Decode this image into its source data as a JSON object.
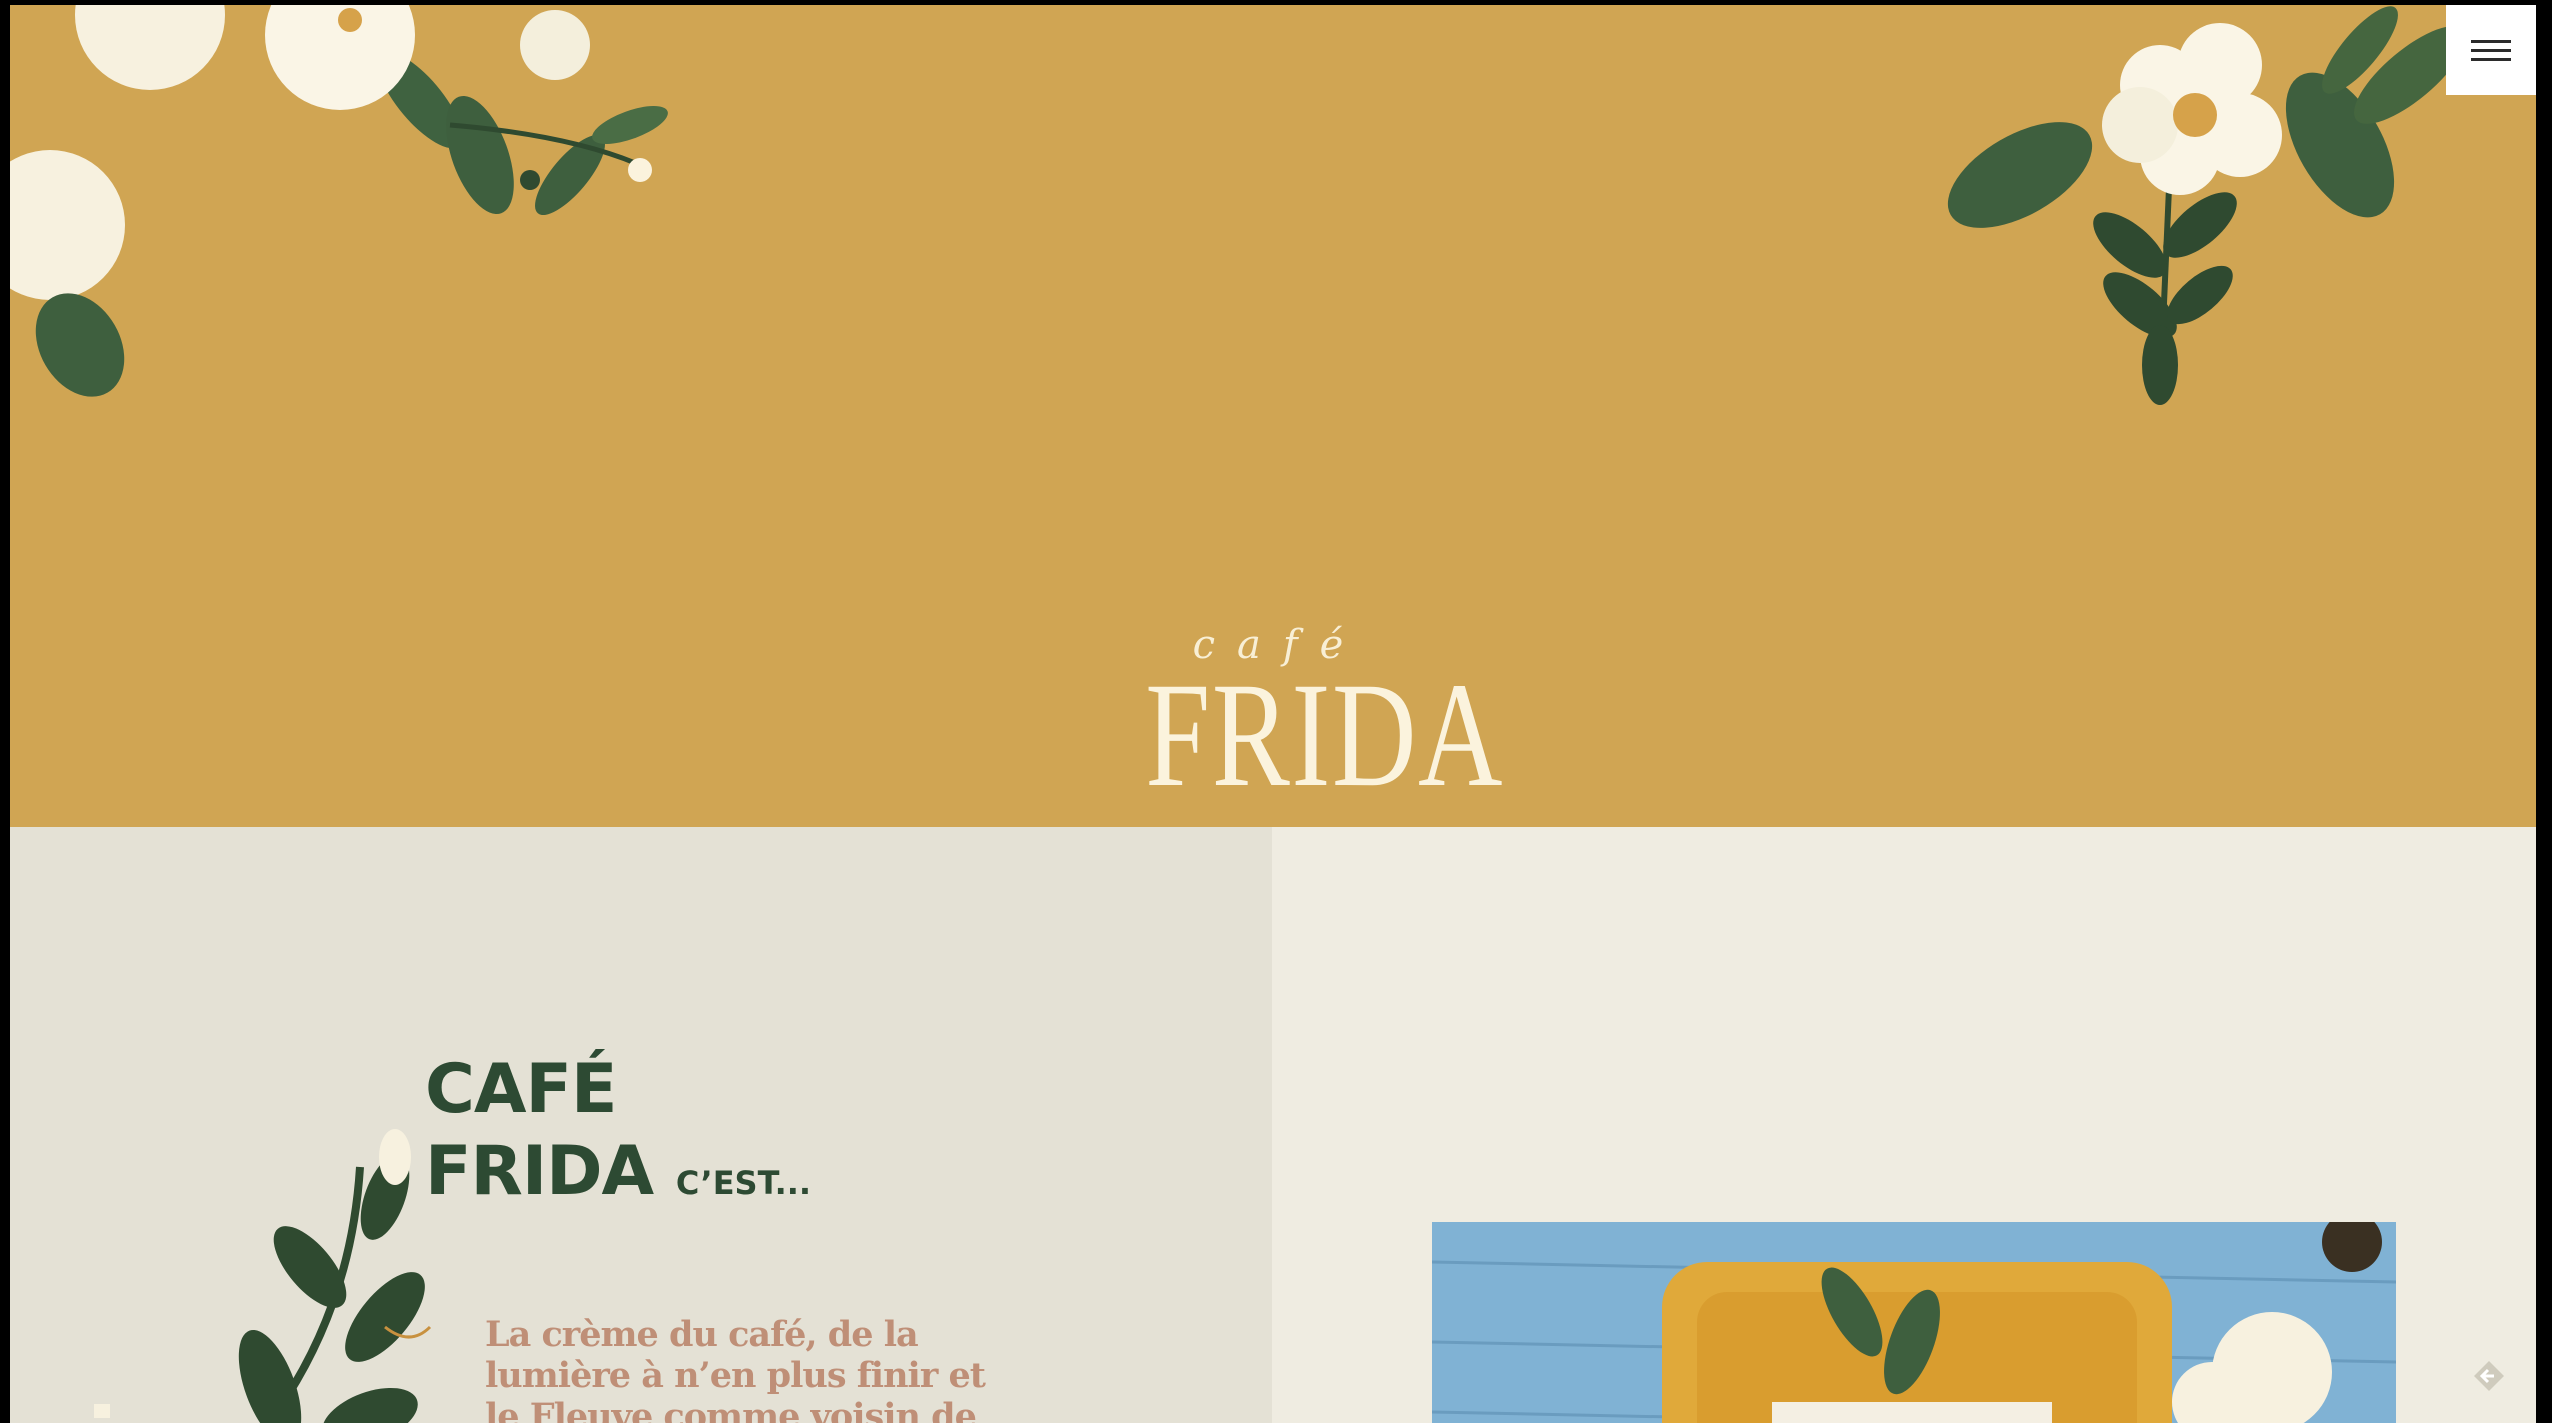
{
  "logo": {
    "small": "café",
    "big": "FRIDA"
  },
  "menu": {
    "icon": "hamburger-menu-icon"
  },
  "about": {
    "title_line1": "CAFÉ",
    "title_line2": "FRIDA",
    "title_suffix": "C’EST...",
    "intro": "La crème du café, de la lumière à n’en plus finir et le Fleuve comme voisin de table. Bienvenue au Frida"
  },
  "colors": {
    "mustard": "#d0a553",
    "cream": "#efece1",
    "panel": "#e4e1d5",
    "green": "#2d4a33",
    "rose": "#bf8f77"
  }
}
